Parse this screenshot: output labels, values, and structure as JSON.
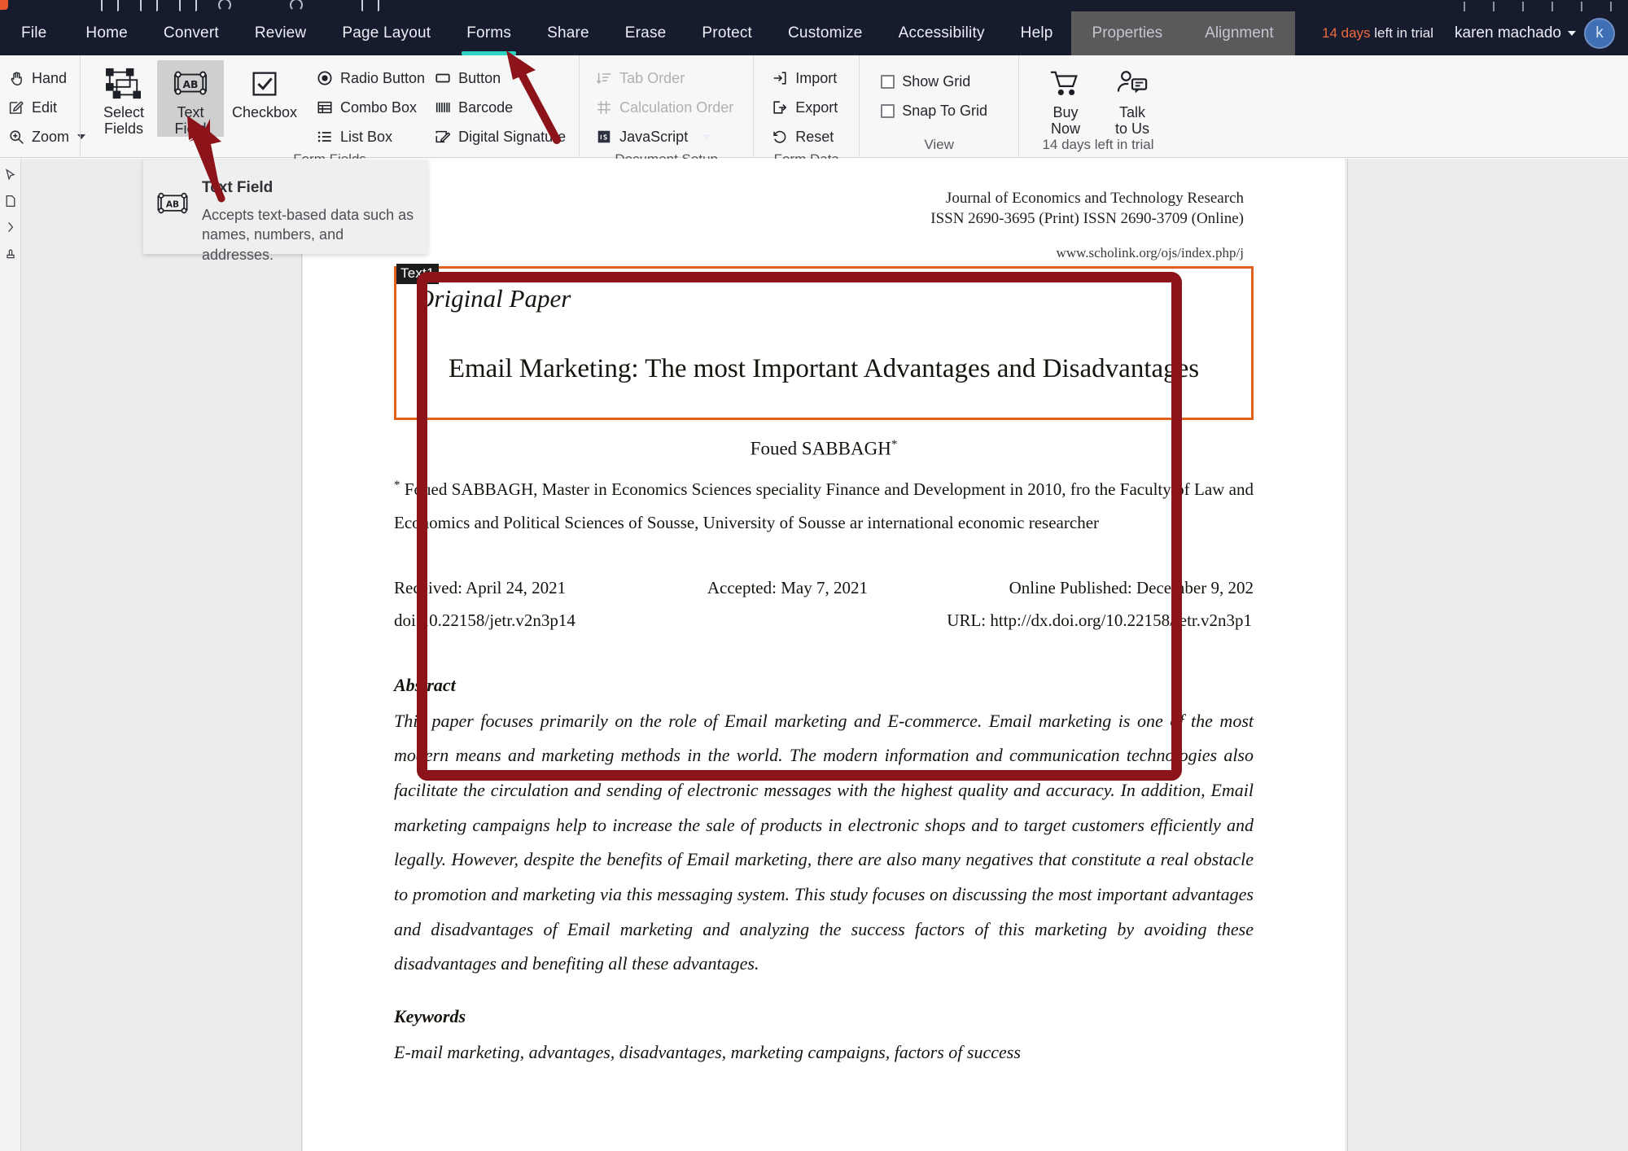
{
  "app": {
    "menu_items": [
      {
        "label": "File",
        "active": false
      },
      {
        "label": "Home",
        "active": false
      },
      {
        "label": "Convert",
        "active": false
      },
      {
        "label": "Review",
        "active": false
      },
      {
        "label": "Page Layout",
        "active": false
      },
      {
        "label": "Forms",
        "active": true
      },
      {
        "label": "Share",
        "active": false
      },
      {
        "label": "Erase",
        "active": false
      },
      {
        "label": "Protect",
        "active": false
      },
      {
        "label": "Customize",
        "active": false
      },
      {
        "label": "Accessibility",
        "active": false
      },
      {
        "label": "Help",
        "active": false
      }
    ],
    "context_tabs": [
      {
        "label": "Properties"
      },
      {
        "label": "Alignment"
      }
    ],
    "trial": {
      "days": "14 days",
      "rest": " left in trial"
    },
    "user": {
      "name": "karen machado",
      "avatar_initial": "k"
    },
    "accent_color": "#2fd3c4",
    "menubar_color": "#171b2e"
  },
  "ribbon": {
    "tools": [
      {
        "label": "Hand",
        "icon": "hand-icon",
        "caret": false
      },
      {
        "label": "Edit",
        "icon": "edit-icon",
        "caret": false
      },
      {
        "label": "Zoom",
        "icon": "zoom-icon",
        "caret": true
      }
    ],
    "form_fields": {
      "group_label": "Form Fields",
      "big_buttons": [
        {
          "label_line1": "Select",
          "label_line2": "Fields",
          "icon": "select-fields-icon",
          "selected": false
        },
        {
          "label_line1": "Text",
          "label_line2": "Field",
          "icon": "text-field-icon",
          "selected": true
        },
        {
          "label_line1": "Checkbox",
          "label_line2": "",
          "icon": "checkbox-icon",
          "selected": false
        }
      ],
      "column_a": [
        {
          "label": "Radio Button",
          "icon": "radio-button-icon"
        },
        {
          "label": "Combo Box",
          "icon": "combo-box-icon"
        },
        {
          "label": "List Box",
          "icon": "list-box-icon"
        }
      ],
      "column_b": [
        {
          "label": "Button",
          "icon": "button-icon"
        },
        {
          "label": "Barcode",
          "icon": "barcode-icon"
        },
        {
          "label": "Digital Signature",
          "icon": "digital-signature-icon"
        }
      ]
    },
    "document_setup": {
      "group_label": "Document Setup",
      "items": [
        {
          "label": "Tab Order",
          "icon": "tab-order-icon",
          "disabled": true,
          "caret": false
        },
        {
          "label": "Calculation Order",
          "icon": "calculation-order-icon",
          "disabled": true,
          "caret": false
        },
        {
          "label": "JavaScript",
          "icon": "javascript-icon",
          "disabled": false,
          "caret": true
        }
      ]
    },
    "form_data": {
      "group_label": "Form Data",
      "items": [
        {
          "label": "Import",
          "icon": "import-icon"
        },
        {
          "label": "Export",
          "icon": "export-icon"
        },
        {
          "label": "Reset",
          "icon": "reset-icon"
        }
      ]
    },
    "view": {
      "group_label": "View",
      "items": [
        {
          "label": "Show Grid",
          "checked": false
        },
        {
          "label": "Snap To Grid",
          "checked": false
        }
      ]
    },
    "purchase": {
      "group_label": "14 days left in trial",
      "items": [
        {
          "label_line1": "Buy",
          "label_line2": "Now",
          "icon": "cart-icon"
        },
        {
          "label_line1": "Talk",
          "label_line2": "to Us",
          "icon": "talk-to-us-icon"
        }
      ]
    }
  },
  "tooltip": {
    "icon": "text-field-icon",
    "title": "Text Field",
    "description": "Accepts text-based data such as names, numbers, and addresses."
  },
  "rail": {
    "items": [
      {
        "icon": "cursor-icon"
      },
      {
        "icon": "page-thumbnail-icon"
      },
      {
        "icon": "bookmark-icon"
      },
      {
        "icon": "stamp-icon"
      }
    ]
  },
  "document": {
    "journal_line1": "Journal of Economics and Technology Research",
    "journal_line2": "ISSN 2690-3695 (Print) ISSN 2690-3709 (Online)",
    "journal_url": "www.scholink.org/ojs/index.php/j",
    "field_tag": "Text1",
    "field_border_color": "#e0611e",
    "original_paper": "Original Paper",
    "title": "Email Marketing: The most Important Advantages and Disadvantages",
    "author": "Foued SABBAGH",
    "affiliation": "Foued SABBAGH, Master in Economics Sciences speciality Finance and Development in 2010, fro the Faculty of Law and Economics and Political Sciences of Sousse, University of Sousse ar international economic researcher",
    "received": "Received: April 24, 2021",
    "accepted": "Accepted: May 7, 2021",
    "published": "Online Published: December 9, 202",
    "doi": "doi:10.22158/jetr.v2n3p14",
    "url": "URL: http://dx.doi.org/10.22158/jetr.v2n3p1",
    "abstract_heading": "Abstract",
    "abstract_body": "This paper focuses primarily on the role of Email marketing and E-commerce. Email marketing is one of the most modern means and marketing methods in the world. The modern information and communication technologies also facilitate the circulation and sending of electronic messages with the highest quality and accuracy. In addition, Email marketing campaigns help to increase the sale of products in electronic shops and to target customers efficiently and legally. However, despite the benefits of Email marketing, there are also many negatives that constitute a real obstacle to promotion and marketing via this messaging system. This study focuses on discussing the most important advantages and disadvantages of Email marketing and analyzing the success factors of this marketing by avoiding these disadvantages and benefiting all these advantages.",
    "keywords_heading": "Keywords",
    "keywords_body": "E-mail marketing, advantages, disadvantages, marketing campaigns, factors of success"
  },
  "annotations": {
    "highlight_color": "#8b1319",
    "arrow_count": 2
  }
}
